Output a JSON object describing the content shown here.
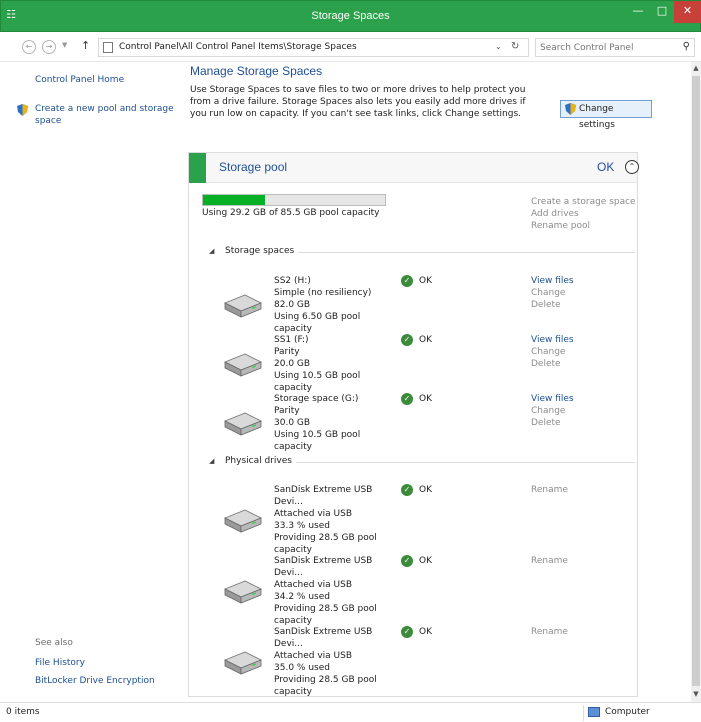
{
  "window": {
    "title": "Storage Spaces"
  },
  "nav": {
    "path": "Control Panel\\All Control Panel Items\\Storage Spaces",
    "search_placeholder": "Search Control Panel"
  },
  "left": {
    "home": "Control Panel Home",
    "create_pool": "Create a new pool and storage space",
    "see_also": "See also",
    "file_history": "File History",
    "bitlocker": "BitLocker Drive Encryption"
  },
  "main": {
    "heading": "Manage Storage Spaces",
    "description": "Use Storage Spaces to save files to two or more drives to help protect you from a drive failure. Storage Spaces also lets you easily add more drives if you run low on capacity. If you can't see task links, click Change settings.",
    "change_settings": "Change settings"
  },
  "pool": {
    "title": "Storage pool",
    "status": "OK",
    "capacity_text": "Using 29.2 GB of 85.5 GB pool capacity",
    "used_fraction": 0.34,
    "actions": [
      "Create a storage space",
      "Add drives",
      "Rename pool"
    ],
    "spaces_label": "Storage spaces",
    "drives_label": "Physical drives"
  },
  "spaces": [
    {
      "name": "SS2 (H:)",
      "type": "Simple (no resiliency)",
      "size": "82.0 GB",
      "usage": "Using 6.50 GB pool capacity",
      "status": "OK",
      "view": "View files",
      "change": "Change",
      "delete": "Delete"
    },
    {
      "name": "SS1 (F:)",
      "type": "Parity",
      "size": "20.0 GB",
      "usage": "Using 10.5 GB pool capacity",
      "status": "OK",
      "view": "View files",
      "change": "Change",
      "delete": "Delete"
    },
    {
      "name": "Storage space (G:)",
      "type": "Parity",
      "size": "30.0 GB",
      "usage": "Using 10.5 GB pool capacity",
      "status": "OK",
      "view": "View files",
      "change": "Change",
      "delete": "Delete"
    }
  ],
  "drives": [
    {
      "name": "SanDisk Extreme USB Devi...",
      "attach": "Attached via USB",
      "used": "33.3 % used",
      "provide": "Providing 28.5 GB pool",
      "provide2": "capacity",
      "status": "OK",
      "action": "Rename"
    },
    {
      "name": "SanDisk Extreme USB Devi...",
      "attach": "Attached via USB",
      "used": "34.2 % used",
      "provide": "Providing 28.5 GB pool",
      "provide2": "capacity",
      "status": "OK",
      "action": "Rename"
    },
    {
      "name": "SanDisk Extreme USB Devi...",
      "attach": "Attached via USB",
      "used": "35.0 % used",
      "provide": "Providing 28.5 GB pool",
      "provide2": "capacity",
      "status": "OK",
      "action": "Rename"
    }
  ],
  "statusbar": {
    "items": "0 items",
    "location": "Computer"
  },
  "colors": {
    "accent": "#2aa14a",
    "link": "#1c4f8f",
    "capacity": "#06b025",
    "close": "#c7403a"
  }
}
